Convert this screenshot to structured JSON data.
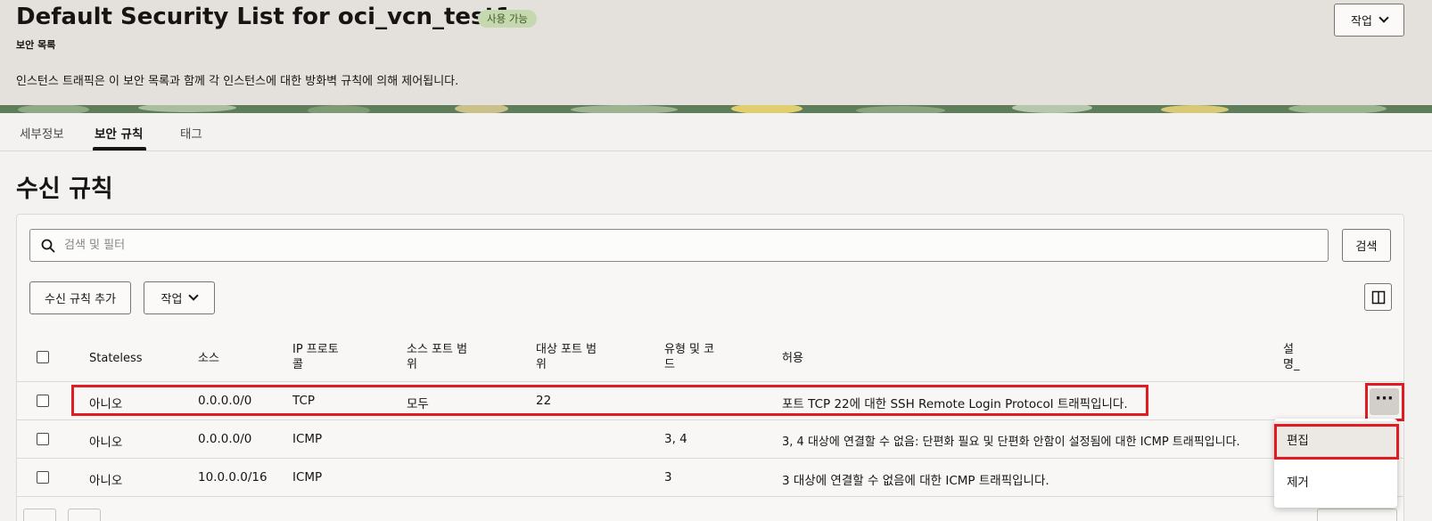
{
  "header": {
    "title": "Default Security List for oci_vcn_test1",
    "status": "사용 가능",
    "subtitle": "보안 목록",
    "description": "인스턴스 트래픽은 이 보안 목록과 함께 각 인스턴스에 대한 방화벽 규칙에 의해 제어됩니다.",
    "action_label": "작업"
  },
  "tabs": [
    {
      "label": "세부정보"
    },
    {
      "label": "보안 규칙"
    },
    {
      "label": "태그"
    }
  ],
  "section": {
    "title": "수신 규칙",
    "search_placeholder": "검색 및 필터",
    "search_button": "검색",
    "add_button": "수신 규칙 추가",
    "action_button": "작업"
  },
  "columns": {
    "stateless": "Stateless",
    "source": "소스",
    "ip_protocol_1": "IP 프로토",
    "ip_protocol_2": "콜",
    "src_port_1": "소스 포트 범",
    "src_port_2": "위",
    "dst_port_1": "대상 포트 범",
    "dst_port_2": "위",
    "type_code_1": "유형 및 코",
    "type_code_2": "드",
    "allows": "허용",
    "desc_1": "설",
    "desc_2": "명_"
  },
  "rows": [
    {
      "stateless": "아니오",
      "source": "0.0.0.0/0",
      "protocol": "TCP",
      "src_port": "모두",
      "dst_port": "22",
      "type_code": "",
      "allows": "포트 TCP 22에 대한 SSH Remote Login Protocol 트래픽입니다."
    },
    {
      "stateless": "아니오",
      "source": "0.0.0.0/0",
      "protocol": "ICMP",
      "src_port": "",
      "dst_port": "",
      "type_code": "3, 4",
      "allows": "3, 4 대상에 연결할 수 없음: 단편화 필요 및 단편화 안함이 설정됨에 대한 ICMP 트래픽입니다."
    },
    {
      "stateless": "아니오",
      "source": "10.0.0.0/16",
      "protocol": "ICMP",
      "src_port": "",
      "dst_port": "",
      "type_code": "3",
      "allows": "3 대상에 연결할 수 없음에 대한 ICMP 트래픽입니다."
    }
  ],
  "row_menu": {
    "edit": "편집",
    "remove": "제거"
  },
  "colors": {
    "highlight": "#e01b22",
    "badge_bg": "#c5d8b0",
    "header_bg": "#e4e1dc"
  },
  "icons": {
    "search": "search-icon",
    "chevron": "chevron-down-icon",
    "columns": "columns-icon",
    "more": "more-horizontal-icon"
  }
}
